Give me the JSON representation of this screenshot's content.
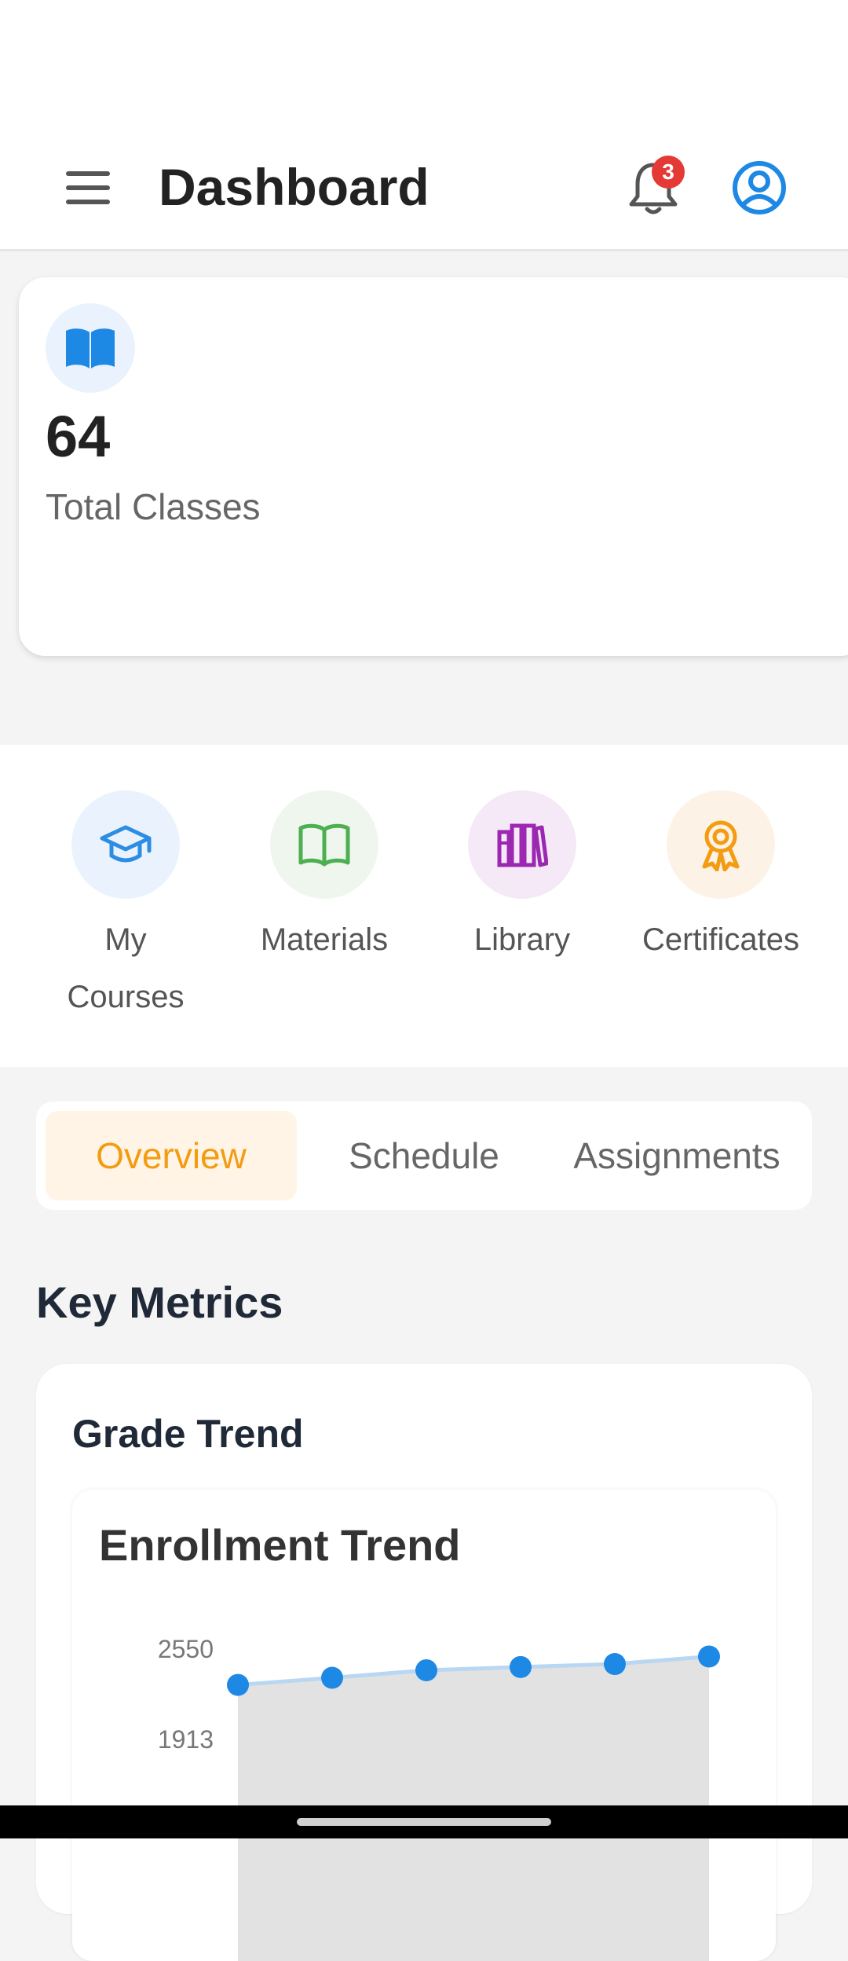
{
  "header": {
    "title": "Dashboard",
    "notification_count": "3",
    "icons": {
      "menu": "menu-icon",
      "bell": "bell-icon",
      "profile": "account-icon"
    }
  },
  "stat_card": {
    "value": "64",
    "label": "Total Classes",
    "icon": "open-book-icon",
    "accent": "#1e88e5"
  },
  "quick_actions": [
    {
      "label": "My\nCourses",
      "icon": "graduation-cap-icon",
      "color": "#2b8de3",
      "bg": "#eaf3fd"
    },
    {
      "label": "Materials",
      "icon": "book-icon",
      "color": "#4caf50",
      "bg": "#eef6ee"
    },
    {
      "label": "Library",
      "icon": "books-icon",
      "color": "#9c27b0",
      "bg": "#f5e9f7"
    },
    {
      "label": "Certificates",
      "icon": "award-icon",
      "color": "#f39c12",
      "bg": "#fdf2e6"
    }
  ],
  "tabs": [
    {
      "label": "Overview",
      "active": true
    },
    {
      "label": "Schedule",
      "active": false
    },
    {
      "label": "Assignments",
      "active": false
    }
  ],
  "metrics": {
    "section_title": "Key Metrics",
    "card_title": "Grade Trend",
    "chart_title": "Enrollment Trend"
  },
  "chart_data": {
    "type": "area",
    "title": "Enrollment Trend",
    "y_ticks": [
      "2550",
      "1913"
    ],
    "ylim": [
      1913,
      2550
    ],
    "values": [
      2292,
      2342,
      2395,
      2418,
      2439,
      2492
    ],
    "series_color": "#1e88e5",
    "area_color": "#e2e2e2"
  }
}
